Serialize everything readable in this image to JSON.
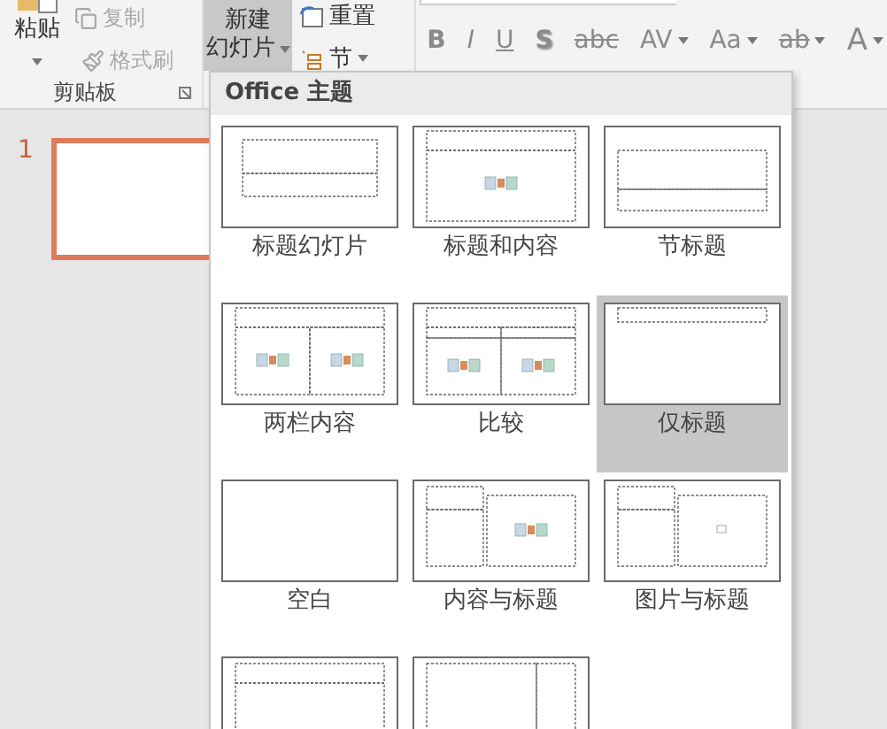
{
  "ribbon": {
    "clipboard": {
      "paste": "粘贴",
      "copy": {
        "label": "复制",
        "disabled": true
      },
      "format_painter": {
        "label": "格式刷",
        "disabled": true
      },
      "group_label": "剪贴板"
    },
    "slides": {
      "new_slide": {
        "line1": "新建",
        "line2": "幻灯片",
        "selected": true
      },
      "reset": "重置",
      "section": "节"
    },
    "font_buttons": [
      {
        "label": "B",
        "kind": "bold"
      },
      {
        "label": "I",
        "kind": "italic"
      },
      {
        "label": "U",
        "kind": "underline"
      },
      {
        "label": "S",
        "kind": "shadow"
      },
      {
        "label": "abc",
        "kind": "strike"
      },
      {
        "label": "AV",
        "kind": "spacing",
        "dropdown": true
      },
      {
        "label": "Aa",
        "kind": "case",
        "dropdown": true
      },
      {
        "label": "ab",
        "kind": "highlight",
        "dropdown": true
      },
      {
        "label": "A",
        "kind": "color",
        "dropdown": true
      }
    ]
  },
  "slide_pane": {
    "slides": [
      {
        "number": "1",
        "selected": true
      }
    ]
  },
  "layout_gallery": {
    "header": "Office 主题",
    "layouts": [
      {
        "label": "标题幻灯片",
        "kind": "title",
        "selected": false
      },
      {
        "label": "标题和内容",
        "kind": "title_content",
        "selected": false
      },
      {
        "label": "节标题",
        "kind": "section",
        "selected": false
      },
      {
        "label": "两栏内容",
        "kind": "two_content",
        "selected": false
      },
      {
        "label": "比较",
        "kind": "comparison",
        "selected": false
      },
      {
        "label": "仅标题",
        "kind": "title_only",
        "selected": true
      },
      {
        "label": "空白",
        "kind": "blank",
        "selected": false
      },
      {
        "label": "内容与标题",
        "kind": "content_caption",
        "selected": false
      },
      {
        "label": "图片与标题",
        "kind": "picture_caption",
        "selected": false
      },
      {
        "kind": "title_vertical_text",
        "selected": false
      },
      {
        "kind": "vertical_title_text",
        "selected": false
      }
    ]
  }
}
